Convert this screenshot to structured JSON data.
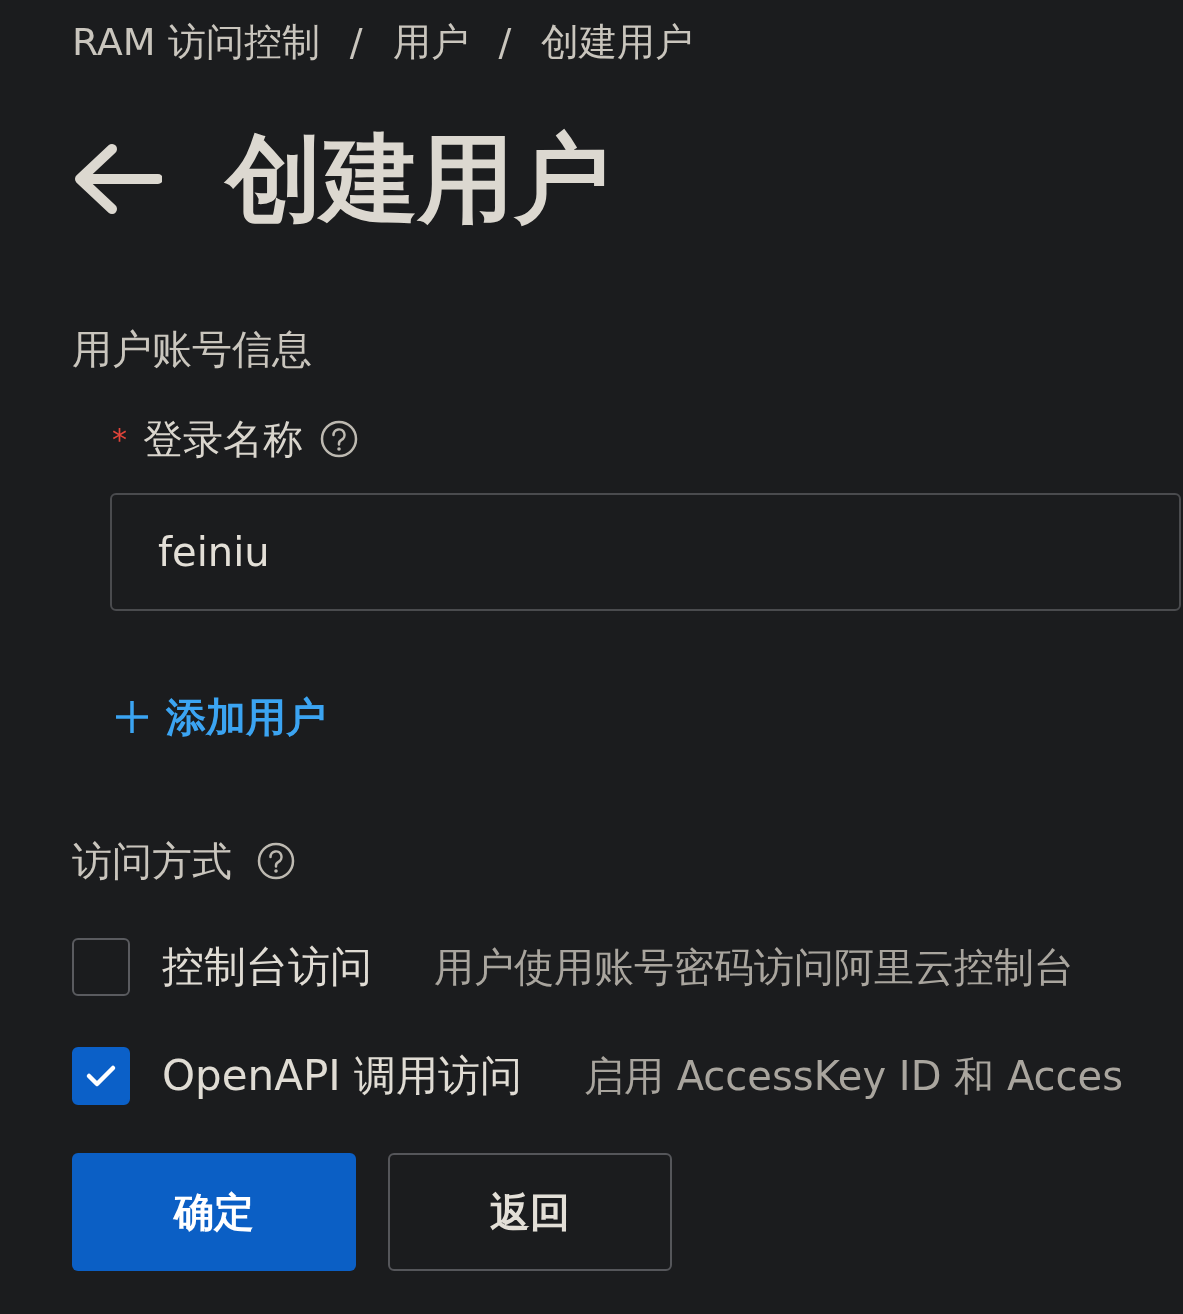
{
  "breadcrumb": [
    "RAM 访问控制",
    "用户",
    "创建用户"
  ],
  "breadcrumb_separator": "/",
  "title": "创建用户",
  "account_section": {
    "heading": "用户账号信息",
    "field": {
      "required_mark": "*",
      "label": "登录名称",
      "value": "feiniu"
    },
    "add_link": "添加用户"
  },
  "access_section": {
    "heading": "访问方式",
    "options": [
      {
        "label": "控制台访问",
        "description": "用户使用账号密码访问阿里云控制台",
        "checked": false
      },
      {
        "label": "OpenAPI 调用访问",
        "description": "启用 AccessKey ID 和 Acces",
        "checked": true
      }
    ]
  },
  "buttons": [
    {
      "label": "确定",
      "kind": "primary"
    },
    {
      "label": "返回",
      "kind": "secondary"
    }
  ]
}
